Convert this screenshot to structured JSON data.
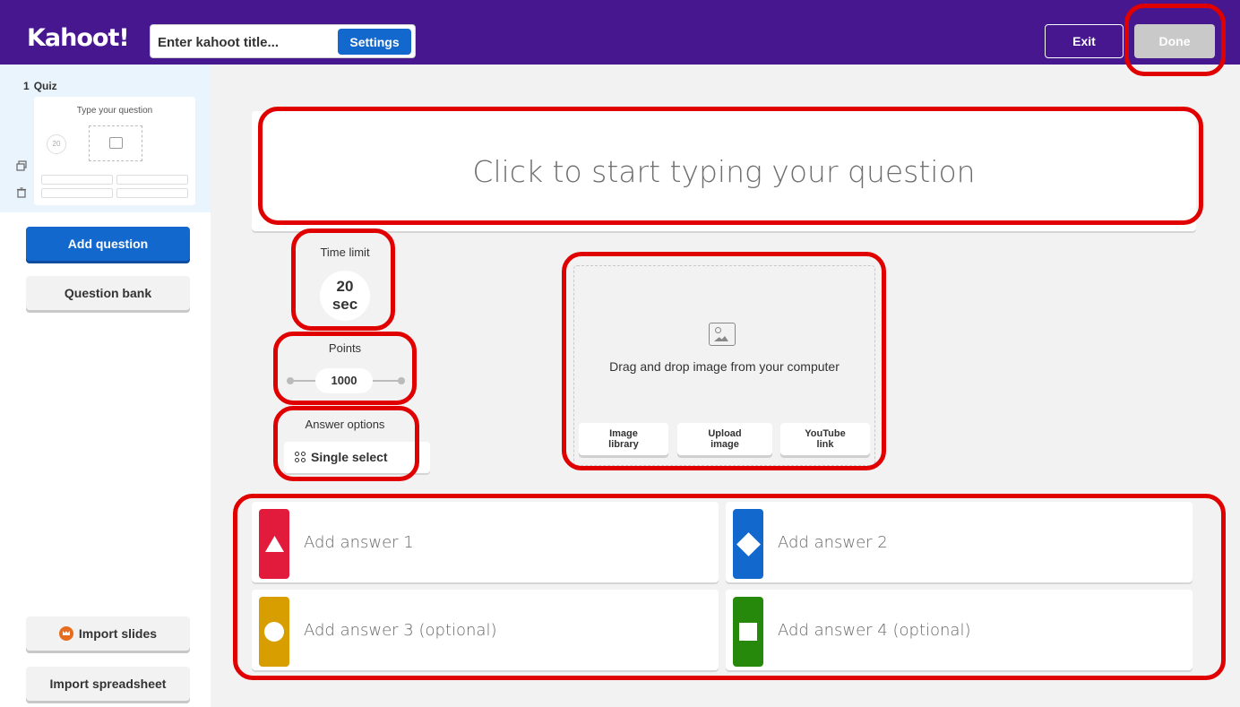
{
  "header": {
    "logo": "Kahoot!",
    "title_placeholder": "Enter kahoot title...",
    "settings_label": "Settings",
    "exit_label": "Exit",
    "done_label": "Done"
  },
  "sidebar": {
    "slide": {
      "number": "1",
      "type": "Quiz",
      "thumb_question": "Type your question",
      "thumb_timer": "20"
    },
    "add_question": "Add question",
    "question_bank": "Question bank",
    "import_slides": "Import slides",
    "import_spreadsheet": "Import spreadsheet"
  },
  "question": {
    "placeholder": "Click to start typing your question"
  },
  "time_limit": {
    "label": "Time limit",
    "value": "20",
    "unit": "sec"
  },
  "points": {
    "label": "Points",
    "value": "1000"
  },
  "answer_options": {
    "label": "Answer options",
    "value": "Single select"
  },
  "media": {
    "drop_text": "Drag and drop image from your computer",
    "buttons": [
      {
        "line1": "Image",
        "line2": "library"
      },
      {
        "line1": "Upload",
        "line2": "image"
      },
      {
        "line1": "YouTube",
        "line2": "link"
      }
    ]
  },
  "answers": [
    {
      "placeholder": "Add answer 1",
      "color": "#e21b3c",
      "shape": "triangle"
    },
    {
      "placeholder": "Add answer 2",
      "color": "#1368ce",
      "shape": "diamond"
    },
    {
      "placeholder": "Add answer 3 (optional)",
      "color": "#d89e00",
      "shape": "circle"
    },
    {
      "placeholder": "Add answer 4 (optional)",
      "color": "#26890c",
      "shape": "square"
    }
  ],
  "colors": {
    "header": "#46178f",
    "accent": "#1368ce",
    "highlight": "#e00000"
  }
}
